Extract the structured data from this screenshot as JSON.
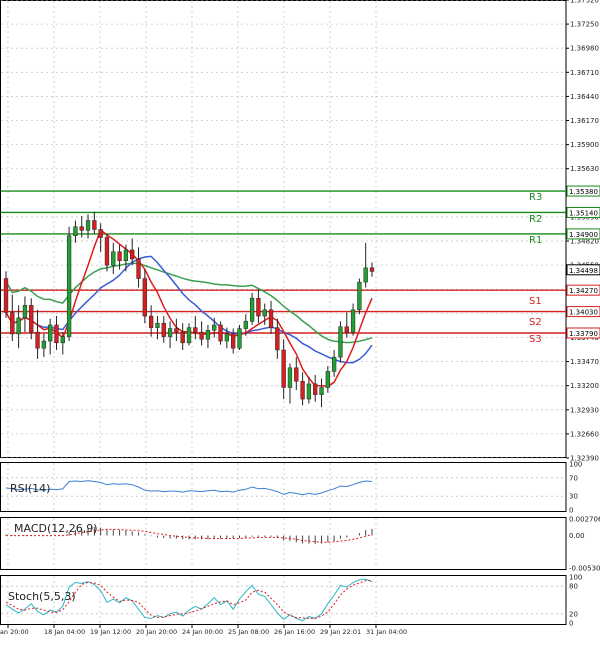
{
  "chart_data": {
    "type": "candlestick",
    "symbol_hint": "USD/CAD-like FX pair",
    "colors": {
      "bull": "#22a033",
      "bear": "#d42020",
      "grid": "#c8c8c8",
      "ma_fast": "#e01b1b",
      "ma_mid": "#3a5bd8",
      "ma_slow": "#3aa050",
      "level_res": "#1a8a1a",
      "level_sup": "#d42020",
      "rsi": "#3a7fd8",
      "macd_hist": "#444444",
      "macd_signal": "#e01b1b",
      "stoch_k": "#2bb5c8",
      "stoch_d": "#e01b1b"
    },
    "price_axis": {
      "ylim": [
        1.3239,
        1.3752
      ],
      "ticks": [
        "1.37520",
        "1.37250",
        "1.36980",
        "1.36710",
        "1.36440",
        "1.36170",
        "1.35900",
        "1.35630",
        "1.35380",
        "1.35090",
        "1.34820",
        "1.34550",
        "1.34280",
        "1.34010",
        "1.33740",
        "1.33470",
        "1.33200",
        "1.32930",
        "1.32660",
        "1.32390"
      ]
    },
    "current_price": {
      "label": "1.34498",
      "value": 1.34498
    },
    "levels": [
      {
        "name": "R3",
        "value": 1.3538,
        "label": "1.35380",
        "kind": "resistance"
      },
      {
        "name": "R2",
        "value": 1.3514,
        "label": "1.35140",
        "kind": "resistance"
      },
      {
        "name": "R1",
        "value": 1.349,
        "label": "1.34900",
        "kind": "resistance"
      },
      {
        "name": "",
        "value": 1.3427,
        "label": "1.34270",
        "kind": "support"
      },
      {
        "name": "S1",
        "value": 1.3403,
        "label": "1.34030",
        "kind": "support"
      },
      {
        "name": "S2",
        "value": 1.3379,
        "label": "1.33790",
        "kind": "support"
      },
      {
        "name": "S3",
        "value": null,
        "label": "",
        "kind": "support"
      }
    ],
    "time_axis": {
      "labels": [
        "Jan 20:00",
        "18 Jan 04:00",
        "19 Jan 12:00",
        "20 Jan 20:00",
        "24 Jan 00:00",
        "25 Jan 08:00",
        "26 Jan 16:00",
        "29 Jan 22:01",
        "31 Jan 04:00"
      ],
      "label_bar_index": [
        1,
        12,
        22,
        32,
        42,
        52,
        62,
        72,
        82
      ]
    },
    "candles": [
      [
        1.344,
        1.3448,
        1.3396,
        1.3402
      ],
      [
        1.3402,
        1.3422,
        1.337,
        1.3378
      ],
      [
        1.3378,
        1.341,
        1.3362,
        1.3396
      ],
      [
        1.3396,
        1.342,
        1.338,
        1.341
      ],
      [
        1.341,
        1.3418,
        1.3372,
        1.338
      ],
      [
        1.338,
        1.3405,
        1.335,
        1.3362
      ],
      [
        1.3362,
        1.3378,
        1.3352,
        1.337
      ],
      [
        1.337,
        1.3395,
        1.3355,
        1.3388
      ],
      [
        1.3388,
        1.3398,
        1.336,
        1.3368
      ],
      [
        1.3368,
        1.338,
        1.3355,
        1.3375
      ],
      [
        1.3375,
        1.3498,
        1.337,
        1.3488
      ],
      [
        1.3488,
        1.3505,
        1.348,
        1.3498
      ],
      [
        1.3498,
        1.351,
        1.3486,
        1.3494
      ],
      [
        1.3494,
        1.3512,
        1.3485,
        1.3505
      ],
      [
        1.3505,
        1.3515,
        1.349,
        1.3495
      ],
      [
        1.3495,
        1.3502,
        1.347,
        1.3486
      ],
      [
        1.3486,
        1.349,
        1.3448,
        1.3455
      ],
      [
        1.3455,
        1.348,
        1.3445,
        1.347
      ],
      [
        1.347,
        1.3478,
        1.345,
        1.346
      ],
      [
        1.346,
        1.3478,
        1.3448,
        1.3472
      ],
      [
        1.3472,
        1.3485,
        1.3455,
        1.3462
      ],
      [
        1.3462,
        1.3475,
        1.343,
        1.344
      ],
      [
        1.344,
        1.345,
        1.339,
        1.3398
      ],
      [
        1.3398,
        1.341,
        1.3375,
        1.3385
      ],
      [
        1.3385,
        1.3398,
        1.3372,
        1.339
      ],
      [
        1.339,
        1.3398,
        1.3368,
        1.3375
      ],
      [
        1.3375,
        1.3392,
        1.3362,
        1.3384
      ],
      [
        1.3384,
        1.3395,
        1.337,
        1.338
      ],
      [
        1.338,
        1.339,
        1.336,
        1.3368
      ],
      [
        1.3368,
        1.339,
        1.3365,
        1.3385
      ],
      [
        1.3385,
        1.3398,
        1.3372,
        1.338
      ],
      [
        1.338,
        1.3392,
        1.3365,
        1.3372
      ],
      [
        1.3372,
        1.3388,
        1.3362,
        1.3382
      ],
      [
        1.3382,
        1.3396,
        1.3374,
        1.3388
      ],
      [
        1.3388,
        1.3392,
        1.3366,
        1.337
      ],
      [
        1.337,
        1.3385,
        1.3362,
        1.3378
      ],
      [
        1.3378,
        1.3384,
        1.3356,
        1.3362
      ],
      [
        1.3362,
        1.3388,
        1.336,
        1.3384
      ],
      [
        1.3384,
        1.34,
        1.3376,
        1.3392
      ],
      [
        1.3392,
        1.3424,
        1.3388,
        1.3418
      ],
      [
        1.3418,
        1.3428,
        1.339,
        1.3398
      ],
      [
        1.3398,
        1.3412,
        1.3388,
        1.3405
      ],
      [
        1.3405,
        1.3415,
        1.3378,
        1.3385
      ],
      [
        1.3385,
        1.3395,
        1.335,
        1.336
      ],
      [
        1.336,
        1.3372,
        1.3305,
        1.3318
      ],
      [
        1.3318,
        1.3345,
        1.33,
        1.334
      ],
      [
        1.334,
        1.3352,
        1.3315,
        1.3325
      ],
      [
        1.3325,
        1.3335,
        1.3298,
        1.3305
      ],
      [
        1.3305,
        1.333,
        1.33,
        1.3322
      ],
      [
        1.3322,
        1.3332,
        1.3302,
        1.331
      ],
      [
        1.331,
        1.3328,
        1.3296,
        1.3318
      ],
      [
        1.3318,
        1.3342,
        1.3312,
        1.3336
      ],
      [
        1.3336,
        1.336,
        1.333,
        1.3352
      ],
      [
        1.3352,
        1.3392,
        1.3346,
        1.3386
      ],
      [
        1.3386,
        1.3402,
        1.3374,
        1.338
      ],
      [
        1.338,
        1.3412,
        1.3376,
        1.3405
      ],
      [
        1.3405,
        1.344,
        1.34,
        1.3436
      ],
      [
        1.3436,
        1.348,
        1.343,
        1.3452
      ],
      [
        1.3452,
        1.3458,
        1.3442,
        1.3448
      ]
    ],
    "indicators": {
      "ma_labels": [
        "",
        "",
        ""
      ],
      "rsi": {
        "label": "RSI(14)",
        "levels": [
          "100",
          "70",
          "30",
          "0"
        ],
        "ylim": [
          0,
          100
        ],
        "values": [
          48,
          46,
          44,
          45,
          47,
          44,
          43,
          45,
          44,
          46,
          62,
          63,
          62,
          64,
          62,
          60,
          55,
          57,
          56,
          57,
          55,
          50,
          43,
          41,
          42,
          40,
          41,
          41,
          39,
          42,
          41,
          40,
          42,
          43,
          40,
          41,
          39,
          43,
          45,
          50,
          46,
          47,
          44,
          40,
          34,
          38,
          36,
          33,
          36,
          34,
          37,
          42,
          46,
          52,
          51,
          55,
          60,
          63,
          62
        ]
      },
      "macd": {
        "label": "MACD(12,26,9)",
        "ticks": [
          "0.002706",
          "0.00",
          "-0.005302"
        ],
        "ylim": [
          -0.005302,
          0.002706
        ],
        "hist": [
          0.0002,
          0.0001,
          0.0,
          0.0001,
          0.0001,
          0.0,
          -0.0001,
          0.0,
          0.0,
          0.0,
          0.0006,
          0.0009,
          0.0011,
          0.0013,
          0.0014,
          0.0013,
          0.0011,
          0.001,
          0.0009,
          0.0008,
          0.0007,
          0.0005,
          0.0002,
          -0.0001,
          -0.0003,
          -0.0004,
          -0.0005,
          -0.0005,
          -0.0006,
          -0.0006,
          -0.0006,
          -0.0006,
          -0.0006,
          -0.0005,
          -0.0005,
          -0.0005,
          -0.0005,
          -0.0004,
          -0.0003,
          -0.0002,
          -0.0002,
          -0.0002,
          -0.0002,
          -0.0004,
          -0.0008,
          -0.0009,
          -0.0011,
          -0.0013,
          -0.0013,
          -0.0014,
          -0.0013,
          -0.0011,
          -0.0009,
          -0.0005,
          -0.0003,
          0.0,
          0.0004,
          0.0009,
          0.0011
        ],
        "signal": [
          0.0,
          0.0,
          0.0,
          0.0,
          0.0,
          0.0,
          0.0,
          0.0,
          0.0,
          0.0,
          0.0001,
          0.0003,
          0.0005,
          0.0006,
          0.0008,
          0.0009,
          0.001,
          0.001,
          0.001,
          0.0009,
          0.0009,
          0.0008,
          0.0007,
          0.0005,
          0.0003,
          0.0002,
          0.0,
          -0.0001,
          -0.0002,
          -0.0003,
          -0.0004,
          -0.0004,
          -0.0005,
          -0.0005,
          -0.0005,
          -0.0005,
          -0.0005,
          -0.0005,
          -0.0004,
          -0.0004,
          -0.0003,
          -0.0003,
          -0.0003,
          -0.0003,
          -0.0004,
          -0.0005,
          -0.0006,
          -0.0008,
          -0.0009,
          -0.001,
          -0.0011,
          -0.0011,
          -0.001,
          -0.0009,
          -0.0008,
          -0.0006,
          -0.0004,
          -0.0001,
          0.0002
        ]
      },
      "stoch": {
        "label": "Stoch(5,5,3)",
        "levels": [
          "100",
          "80",
          "20",
          "0"
        ],
        "ylim": [
          0,
          100
        ],
        "k": [
          40,
          30,
          22,
          30,
          42,
          25,
          18,
          28,
          24,
          36,
          78,
          88,
          86,
          90,
          84,
          70,
          45,
          52,
          44,
          55,
          48,
          30,
          12,
          10,
          16,
          12,
          20,
          24,
          15,
          28,
          36,
          30,
          42,
          55,
          40,
          48,
          30,
          52,
          68,
          82,
          62,
          58,
          40,
          22,
          8,
          18,
          10,
          5,
          14,
          10,
          20,
          42,
          60,
          82,
          78,
          88,
          94,
          95,
          90
        ],
        "d": [
          45,
          38,
          30,
          28,
          32,
          32,
          28,
          24,
          23,
          29,
          46,
          67,
          84,
          88,
          87,
          82,
          67,
          56,
          47,
          50,
          49,
          45,
          30,
          17,
          12,
          13,
          16,
          19,
          20,
          22,
          26,
          31,
          36,
          42,
          46,
          48,
          40,
          44,
          50,
          67,
          71,
          67,
          54,
          40,
          24,
          16,
          12,
          11,
          10,
          10,
          15,
          24,
          41,
          61,
          74,
          82,
          87,
          92,
          93
        ]
      }
    }
  }
}
